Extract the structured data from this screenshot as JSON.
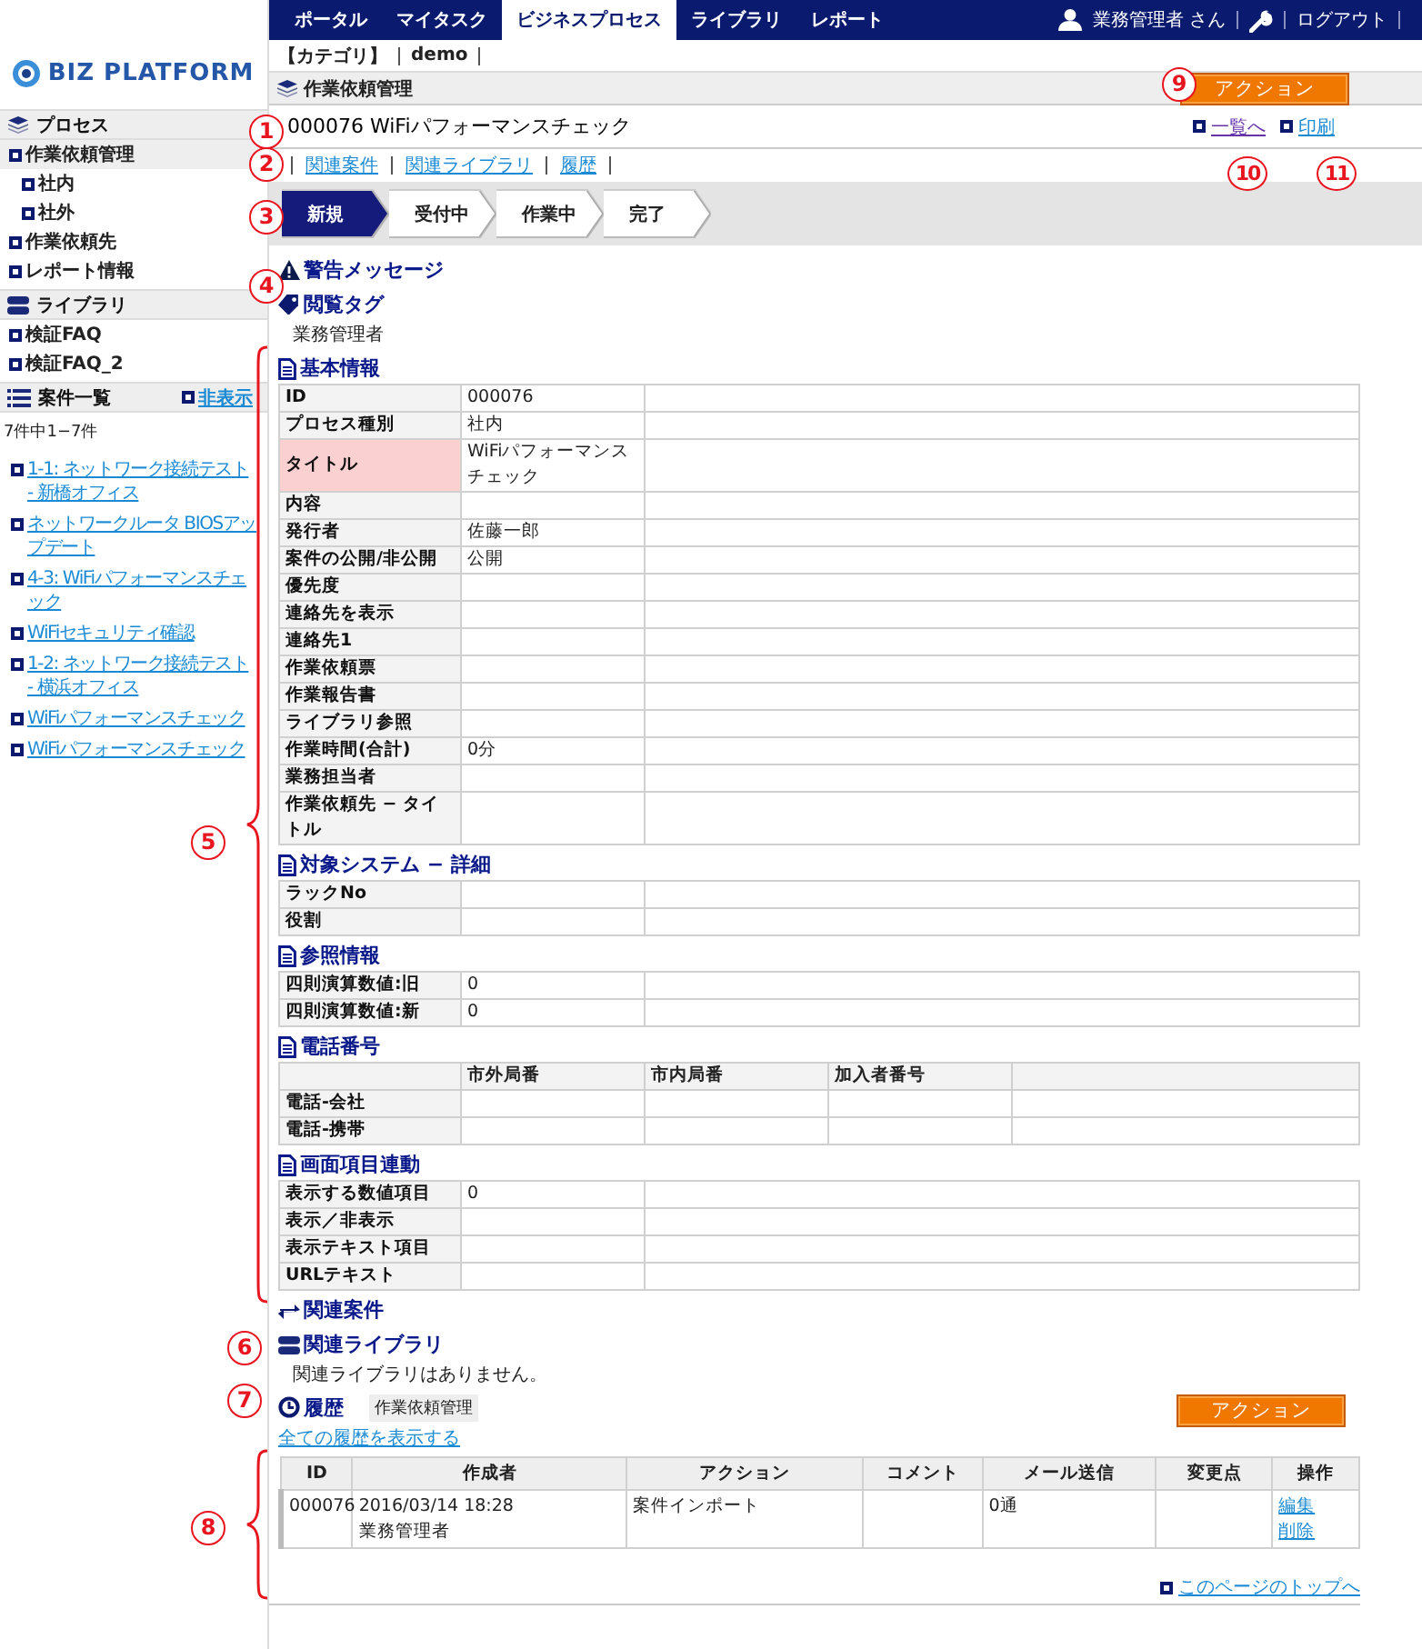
{
  "top_nav": {
    "tabs": [
      {
        "label": "ポータル",
        "selected": false
      },
      {
        "label": "マイタスク",
        "selected": false
      },
      {
        "label": "ビジネスプロセス",
        "selected": true
      },
      {
        "label": "ライブラリ",
        "selected": false
      },
      {
        "label": "レポート",
        "selected": false
      }
    ],
    "user": "業務管理者 さん",
    "logout": "ログアウト"
  },
  "sidebar": {
    "logo": "BIZ PLATFORM",
    "sections": [
      {
        "title": "プロセス",
        "kind": "process",
        "items": [
          {
            "label": "作業依頼管理",
            "selected": true,
            "children": [
              {
                "label": "社内",
                "selected": false
              },
              {
                "label": "社外",
                "selected": false
              }
            ]
          },
          {
            "label": "作業依頼先",
            "selected": false
          },
          {
            "label": "レポート情報",
            "selected": false
          }
        ]
      },
      {
        "title": "ライブラリ",
        "kind": "library",
        "items": [
          {
            "label": "検証FAQ",
            "selected": false
          },
          {
            "label": "検証FAQ_2",
            "selected": false
          }
        ]
      }
    ],
    "case_list": {
      "title": "案件一覧",
      "hide_link": "非表示",
      "count": "7件中1−7件",
      "items": [
        "1-1: ネットワーク接続テスト - 新橋オフィス",
        "ネットワークルータ BIOSアップデート",
        "4-3: WiFiパフォーマンスチェック",
        "WiFiセキュリティ確認",
        "1-2: ネットワーク接続テスト - 横浜オフィス",
        "WiFiパフォーマンスチェック",
        "WiFiパフォーマンスチェック"
      ]
    }
  },
  "breadcrumb": {
    "category": "【カテゴリ】",
    "name": "demo"
  },
  "page_title": "作業依頼管理",
  "action_button": "アクション",
  "record_title": "000076 WiFiパフォーマンスチェック",
  "record_links": [
    {
      "label": "一覧へ",
      "visited": true
    },
    {
      "label": "印刷",
      "visited": false
    }
  ],
  "related_links": [
    "関連案件",
    "関連ライブラリ",
    "履歴"
  ],
  "workflow": [
    {
      "label": "新規",
      "selected": true
    },
    {
      "label": "受付中",
      "selected": false
    },
    {
      "label": "作業中",
      "selected": false
    },
    {
      "label": "完了",
      "selected": false
    }
  ],
  "warning": "警告メッセージ",
  "view_tag": {
    "title": "閲覧タグ",
    "value": "業務管理者"
  },
  "sections": [
    {
      "title": "基本情報",
      "rows": [
        {
          "label": "ID",
          "value": "000076",
          "highlighted": false
        },
        {
          "label": "プロセス種別",
          "value": "社内",
          "highlighted": false
        },
        {
          "label": "タイトル",
          "value": "WiFiパフォーマンスチェック",
          "highlighted": true
        },
        {
          "label": "内容",
          "highlighted": false
        },
        {
          "label": "発行者",
          "value": "佐藤一郎",
          "highlighted": false
        },
        {
          "label": "案件の公開/非公開",
          "value": "公開",
          "highlighted": false
        },
        {
          "label": "優先度",
          "highlighted": false
        },
        {
          "label": "連絡先を表示",
          "highlighted": false
        },
        {
          "label": "連絡先1",
          "highlighted": false
        },
        {
          "label": "作業依頼票",
          "highlighted": false
        },
        {
          "label": "作業報告書",
          "highlighted": false
        },
        {
          "label": "ライブラリ参照",
          "highlighted": false
        },
        {
          "label": "作業時間(合計)",
          "value": "0分",
          "highlighted": false
        },
        {
          "label": "業務担当者",
          "highlighted": false
        },
        {
          "label": "作業依頼先 − タイトル",
          "highlighted": false
        }
      ]
    },
    {
      "title": "対象システム − 詳細",
      "rows": [
        {
          "label": "ラックNo"
        },
        {
          "label": "役割"
        }
      ]
    },
    {
      "title": "参照情報",
      "rows": [
        {
          "label": "四則演算数値:旧",
          "value": "0"
        },
        {
          "label": "四則演算数値:新",
          "value": "0"
        }
      ]
    },
    {
      "title": "電話番号",
      "columns": [
        "市外局番",
        "市内局番",
        "加入者番号"
      ],
      "rows": [
        {
          "label": "電話-会社"
        },
        {
          "label": "電話-携帯"
        }
      ]
    },
    {
      "title": "画面項目連動",
      "rows": [
        {
          "label": "表示する数値項目",
          "value": "0"
        },
        {
          "label": "表示／非表示"
        },
        {
          "label": "表示テキスト項目"
        },
        {
          "label": "URLテキスト"
        }
      ]
    }
  ],
  "related_cases": "関連案件",
  "related_library": {
    "title": "関連ライブラリ",
    "message": "関連ライブラリはありません。"
  },
  "history": {
    "title": "履歴",
    "badge": "作業依頼管理",
    "show_all": "全ての履歴を表示する",
    "action_button": "アクション",
    "columns": [
      "ID",
      "作成者",
      "アクション",
      "コメント",
      "メール送信",
      "変更点",
      "操作"
    ],
    "rows": [
      {
        "id": "000076",
        "date": "2016/03/14 18:28",
        "creator": "業務管理者",
        "action": "案件インポート",
        "mail": "0通",
        "operations": [
          "編集",
          "削除"
        ]
      }
    ]
  },
  "page_top": "このページのトップへ",
  "annotations": [
    {
      "label": "1",
      "kind": "marker"
    },
    {
      "label": "2",
      "kind": "marker"
    },
    {
      "label": "3",
      "kind": "marker"
    },
    {
      "label": "4",
      "kind": "marker"
    },
    {
      "label": "5",
      "kind": "bracket"
    },
    {
      "label": "6",
      "kind": "marker"
    },
    {
      "label": "7",
      "kind": "marker"
    },
    {
      "label": "8",
      "kind": "bracket"
    },
    {
      "label": "9",
      "kind": "marker"
    },
    {
      "label": "10",
      "kind": "marker"
    },
    {
      "label": "11",
      "kind": "marker"
    }
  ]
}
